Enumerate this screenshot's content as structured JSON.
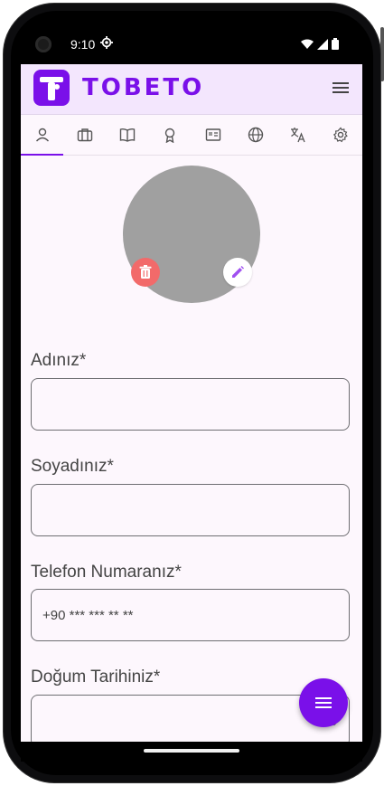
{
  "status_bar": {
    "time": "9:10"
  },
  "app_bar": {
    "logo_text": "TOBETO",
    "menu_icon": "menu-icon",
    "brand_color": "#7a10e9"
  },
  "tabs": [
    {
      "icon": "person-icon",
      "active": true
    },
    {
      "icon": "briefcase-icon",
      "active": false
    },
    {
      "icon": "book-icon",
      "active": false
    },
    {
      "icon": "award-icon",
      "active": false
    },
    {
      "icon": "certificate-icon",
      "active": false
    },
    {
      "icon": "globe-icon",
      "active": false
    },
    {
      "icon": "translate-icon",
      "active": false
    },
    {
      "icon": "settings-icon",
      "active": false
    }
  ],
  "profile": {
    "avatar_color": "#a0a0a0",
    "delete_icon": "trash-icon",
    "edit_icon": "pencil-icon"
  },
  "form": {
    "first_name_label": "Adınız*",
    "first_name_value": "",
    "last_name_label": "Soyadınız*",
    "last_name_value": "",
    "phone_label": "Telefon Numaranız*",
    "phone_placeholder": "+90 *** *** ** **",
    "birth_date_label": "Doğum Tarihiniz*",
    "birth_date_value": ""
  },
  "fab": {
    "icon": "menu-icon"
  }
}
